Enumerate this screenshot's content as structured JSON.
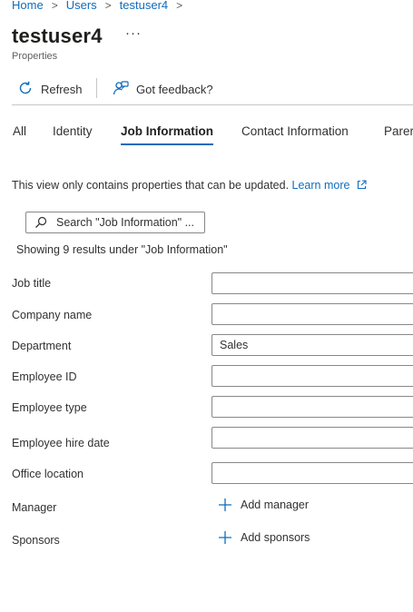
{
  "breadcrumb": [
    "Home",
    "Users",
    "testuser4"
  ],
  "page": {
    "title": "testuser4",
    "more": "···",
    "subtitle": "Properties"
  },
  "toolbar": {
    "refresh_label": "Refresh",
    "feedback_label": "Got feedback?"
  },
  "tabs": [
    "All",
    "Identity",
    "Job Information",
    "Contact Information",
    "Parer"
  ],
  "active_tab": "Job Information",
  "info": {
    "text": "This view only contains properties that can be updated.",
    "learn_more": "Learn more"
  },
  "search": {
    "placeholder": "Search \"Job Information\" ..."
  },
  "results_text": "Showing 9 results under \"Job Information\"",
  "fields": [
    {
      "label": "Job title",
      "value": ""
    },
    {
      "label": "Company name",
      "value": ""
    },
    {
      "label": "Department",
      "value": "Sales"
    },
    {
      "label": "Employee ID",
      "value": ""
    },
    {
      "label": "Employee type",
      "value": ""
    },
    {
      "label": "Employee hire date",
      "value": ""
    },
    {
      "label": "Office location",
      "value": ""
    }
  ],
  "manager": {
    "label": "Manager",
    "action": "Add manager"
  },
  "sponsors": {
    "label": "Sponsors",
    "action": "Add sponsors"
  },
  "colors": {
    "accent": "#0f6cbd",
    "text": "#323130",
    "border": "#8a8886"
  }
}
